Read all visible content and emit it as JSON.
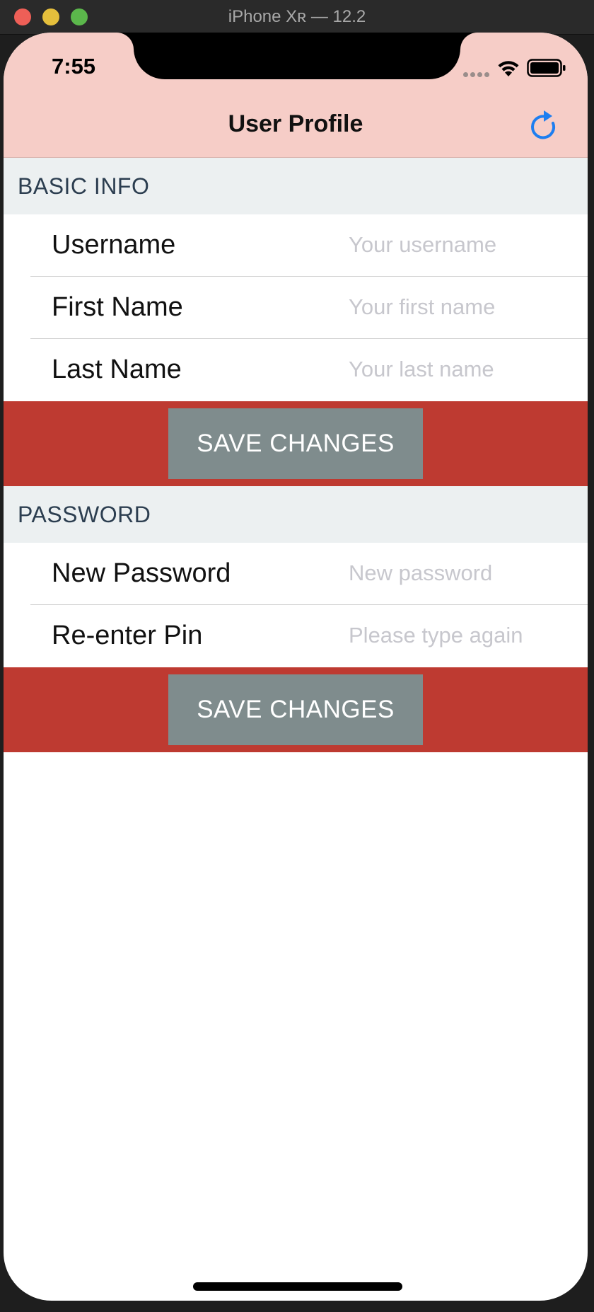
{
  "window": {
    "title": "iPhone Xʀ — 12.2"
  },
  "status_bar": {
    "time": "7:55"
  },
  "nav": {
    "title": "User Profile",
    "refresh_icon": "refresh-icon"
  },
  "sections": {
    "basic_info": {
      "header": "BASIC INFO",
      "fields": [
        {
          "label": "Username",
          "placeholder": "Your username",
          "value": ""
        },
        {
          "label": "First Name",
          "placeholder": "Your first name",
          "value": ""
        },
        {
          "label": "Last Name",
          "placeholder": "Your last name",
          "value": ""
        }
      ],
      "save_label": "SAVE CHANGES"
    },
    "password": {
      "header": "PASSWORD",
      "fields": [
        {
          "label": "New Password",
          "placeholder": "New password",
          "value": ""
        },
        {
          "label": "Re-enter Pin",
          "placeholder": "Please type again",
          "value": ""
        }
      ],
      "save_label": "SAVE CHANGES"
    }
  },
  "colors": {
    "nav_background": "#f6cdc7",
    "section_header_background": "#ecf0f1",
    "button_band": "#be3a31",
    "button": "#7f8c8d",
    "accent": "#1e7ef0"
  }
}
